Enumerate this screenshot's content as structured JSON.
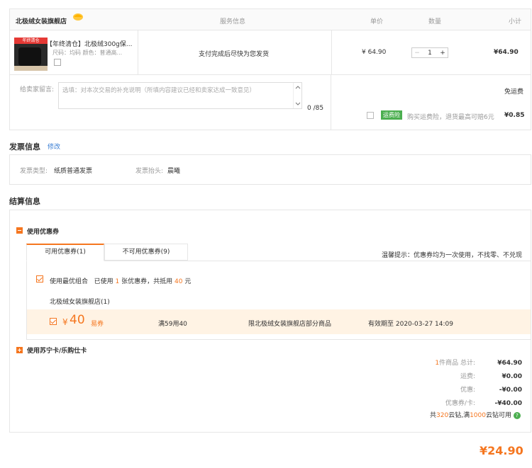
{
  "header": {
    "store_name": "北极绒女装旗舰店",
    "col_service": "服务信息",
    "col_price": "单价",
    "col_qty": "数量",
    "col_subtotal": "小计"
  },
  "product": {
    "thumb_text": "年终清仓",
    "title": "【年终清仓】北极绒300g保...",
    "specs": "尺码：均码   颜色：普通高...",
    "service": "支付完成后尽快为您发货",
    "price": "¥ 64.90",
    "qty_minus": "−",
    "qty_value": "1",
    "qty_plus": "+",
    "subtotal": "¥64.90"
  },
  "message": {
    "label": "给卖家留言:",
    "placeholder": "选填：对本次交易的补充说明（所填内容建议已经和卖家达成一致意见）",
    "count": "0 /85",
    "shipping_label": "免运费",
    "insurance_badge": "运费险",
    "insurance_text": "购买运费险，退货最高可赔6元",
    "insurance_price": "¥0.85"
  },
  "invoice": {
    "title": "发票信息",
    "edit": "修改",
    "type_label": "发票类型:",
    "type_value": "纸质普通发票",
    "header_label": "发票抬头:",
    "header_value": "晨曦"
  },
  "settlement": {
    "title": "结算信息",
    "coupon_section": "使用优惠券",
    "tab_available": "可用优惠券(1)",
    "tab_unavailable": "不可用优惠券(9)",
    "tip": "温馨提示：优惠券均为一次使用，不找零、不兑现",
    "best_combo_label": "使用最优组合",
    "best_combo_pre": "已使用",
    "best_combo_count": "1",
    "best_combo_mid": "张优惠券，共抵用",
    "best_combo_amount": "40",
    "best_combo_unit": "元",
    "store_group": "北极绒女装旗舰店(1)",
    "coupon": {
      "symbol": "¥",
      "amount": "40",
      "type": "易券",
      "condition": "满59用40",
      "scope": "限北极绒女装旗舰店部分商品",
      "expiry": "有效期至 2020-03-27 14:09"
    },
    "card_section": "使用苏宁卡/乐购仕卡"
  },
  "summary": {
    "items_count": "1",
    "items_label": "件商品 总计:",
    "items_total": "¥64.90",
    "shipping_label": "运费:",
    "shipping_value": "¥0.00",
    "discount_label": "优惠:",
    "discount_value": "-¥0.00",
    "coupon_label": "优惠券/卡:",
    "coupon_value": "-¥40.00",
    "points_pre": "共",
    "points_count": "320",
    "points_mid": "云钻,满",
    "points_threshold": "1000",
    "points_post": "云钻可用",
    "total": "¥24.90"
  },
  "colors": {
    "accent": "#f5761f",
    "green": "#4caf50",
    "coupon_bg": "#fff3e4"
  }
}
